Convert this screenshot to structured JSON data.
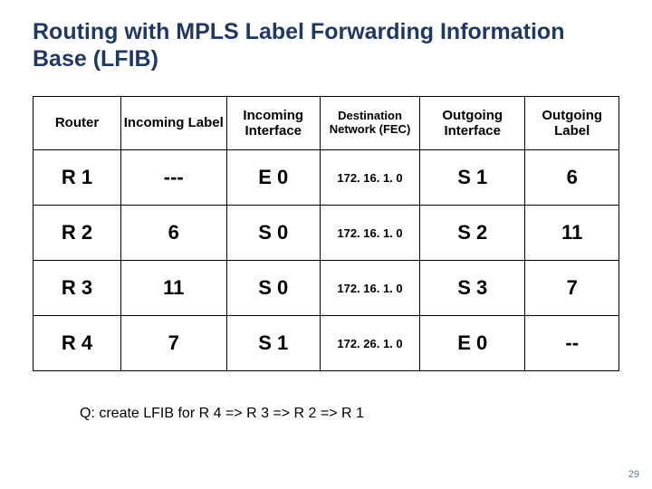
{
  "title": "Routing with MPLS Label Forwarding Information Base (LFIB)",
  "headers": {
    "router": "Router",
    "in_label": "Incoming Label",
    "in_iface": "Incoming Interface",
    "dest_net": "Destination Network (FEC)",
    "out_iface": "Outgoing Interface",
    "out_label": "Outgoing Label"
  },
  "rows": [
    {
      "router": "R 1",
      "in_label": "---",
      "in_iface": "E 0",
      "dest": "172. 16. 1. 0",
      "out_iface": "S 1",
      "out_label": "6"
    },
    {
      "router": "R 2",
      "in_label": "6",
      "in_iface": "S 0",
      "dest": "172. 16. 1. 0",
      "out_iface": "S 2",
      "out_label": "11"
    },
    {
      "router": "R 3",
      "in_label": "11",
      "in_iface": "S 0",
      "dest": "172. 16. 1. 0",
      "out_iface": "S 3",
      "out_label": "7"
    },
    {
      "router": "R 4",
      "in_label": "7",
      "in_iface": "S 1",
      "dest": "172. 26. 1. 0",
      "out_iface": "E 0",
      "out_label": "--"
    }
  ],
  "question": "Q: create LFIB for R 4 => R 3 => R 2 => R 1",
  "page_number": "29",
  "chart_data": {
    "type": "table",
    "title": "Routing with MPLS Label Forwarding Information Base (LFIB)",
    "columns": [
      "Router",
      "Incoming Label",
      "Incoming Interface",
      "Destination Network (FEC)",
      "Outgoing Interface",
      "Outgoing Label"
    ],
    "rows": [
      [
        "R 1",
        "---",
        "E 0",
        "172. 16. 1. 0",
        "S 1",
        "6"
      ],
      [
        "R 2",
        "6",
        "S 0",
        "172. 16. 1. 0",
        "S 2",
        "11"
      ],
      [
        "R 3",
        "11",
        "S 0",
        "172. 16. 1. 0",
        "S 3",
        "7"
      ],
      [
        "R 4",
        "7",
        "S 1",
        "172. 26. 1. 0",
        "E 0",
        "--"
      ]
    ]
  }
}
